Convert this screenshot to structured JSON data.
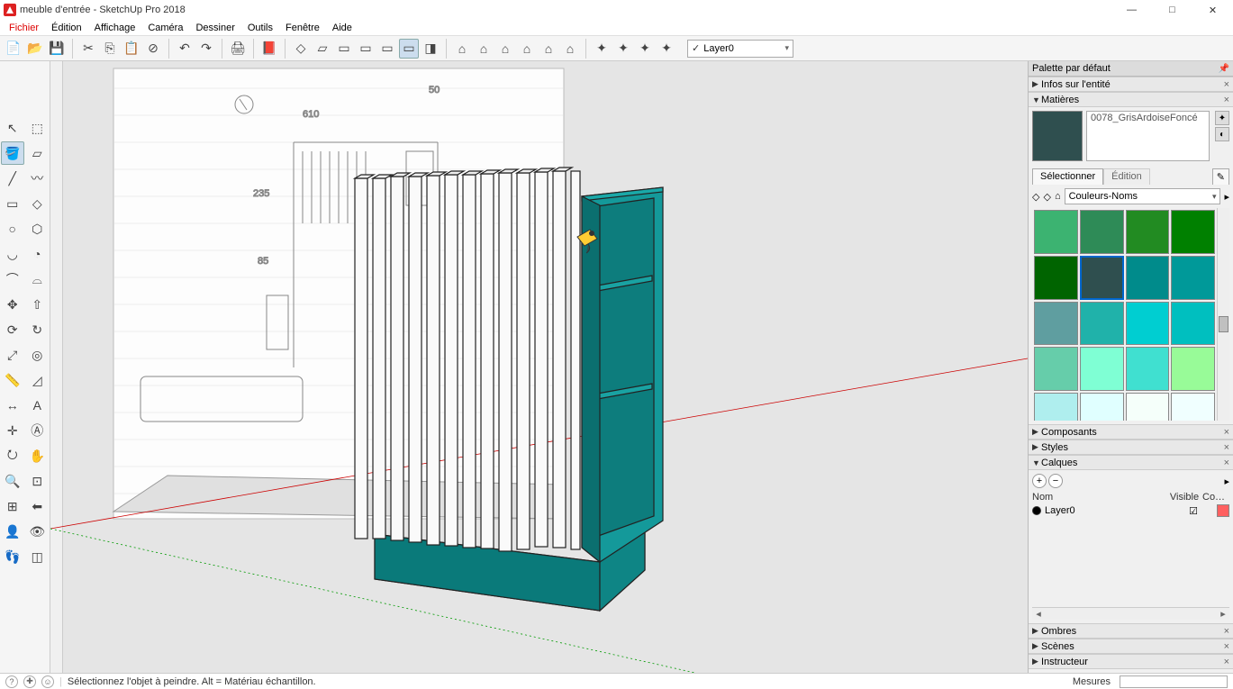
{
  "title": "meuble d'entrée - SketchUp Pro 2018",
  "menus": [
    "Fichier",
    "Édition",
    "Affichage",
    "Caméra",
    "Dessiner",
    "Outils",
    "Fenêtre",
    "Aide"
  ],
  "toolbar": {
    "groups": [
      [
        "new-file",
        "open-file",
        "save-file"
      ],
      [
        "cut",
        "copy",
        "paste",
        "delete"
      ],
      [
        "undo",
        "redo"
      ],
      [
        "print"
      ],
      [
        "model-info"
      ],
      [
        "iso-view",
        "top-view",
        "front-view",
        "back-view",
        "left-view",
        "right-view",
        "shaded-view"
      ],
      [
        "house-1",
        "house-2",
        "house-3",
        "house-4",
        "house-5",
        "house-6"
      ],
      [
        "ext-1",
        "ext-2",
        "ext-3",
        "ext-4"
      ]
    ],
    "layer_selected": "Layer0"
  },
  "tool_palette": [
    [
      "select-tool",
      "component-tool"
    ],
    [
      "paint-bucket",
      "eraser"
    ],
    [
      "line-tool",
      "freehand-tool"
    ],
    [
      "rectangle-tool",
      "rotated-rect-tool"
    ],
    [
      "circle-tool",
      "polygon-tool"
    ],
    [
      "arc-tool",
      "pie-tool"
    ],
    [
      "arc3-tool",
      "arc4-tool"
    ],
    [
      "move-tool",
      "pushpull-tool"
    ],
    [
      "rotate-tool",
      "followme-tool"
    ],
    [
      "scale-tool",
      "offset-tool"
    ],
    [
      "tape-tool",
      "protractor-tool"
    ],
    [
      "dim-tool",
      "text-tool"
    ],
    [
      "axes-tool",
      "3dtext-tool"
    ],
    [
      "orbit-tool",
      "pan-tool"
    ],
    [
      "zoom-tool",
      "zoom-window-tool"
    ],
    [
      "zoom-ext-tool",
      "prev-view-tool"
    ],
    [
      "position-camera",
      "look-around"
    ],
    [
      "walk-tool",
      "section-tool"
    ]
  ],
  "tray": {
    "title": "Palette par défaut",
    "panels_collapsed": [
      "Infos sur l'entité"
    ],
    "materials": {
      "title": "Matières",
      "current_name": "0078_GrisArdoiseFoncé",
      "tab_select": "Sélectionner",
      "tab_edit": "Édition",
      "library": "Couleurs-Noms",
      "swatches": [
        "#3cb371",
        "#2e8b57",
        "#228b22",
        "#008000",
        "#006400",
        "#2f4f4f",
        "#008b8b",
        "#009999",
        "#5f9ea0",
        "#20b2aa",
        "#00ced1",
        "#00bfbf",
        "#66cdaa",
        "#7fffd4",
        "#40e0d0",
        "#98fb98",
        "#afeeee",
        "#e0ffff",
        "#f5fffa",
        "#f0ffff",
        "#b0e0e6",
        "#add8e6",
        "#87ceeb",
        "#87cefa"
      ],
      "selected_swatch_index": 5
    },
    "panels_simple": [
      "Composants",
      "Styles"
    ],
    "layers": {
      "title": "Calques",
      "col_name": "Nom",
      "col_visible": "Visible",
      "col_color": "Co…",
      "rows": [
        {
          "name": "Layer0",
          "visible": true,
          "color": "#ff6060"
        }
      ]
    },
    "panels_bottom": [
      "Ombres",
      "Scènes",
      "Instructeur"
    ]
  },
  "statusbar": {
    "hint": "Sélectionnez l'objet à peindre. Alt = Matériau échantillon.",
    "measures_label": "Mesures"
  }
}
